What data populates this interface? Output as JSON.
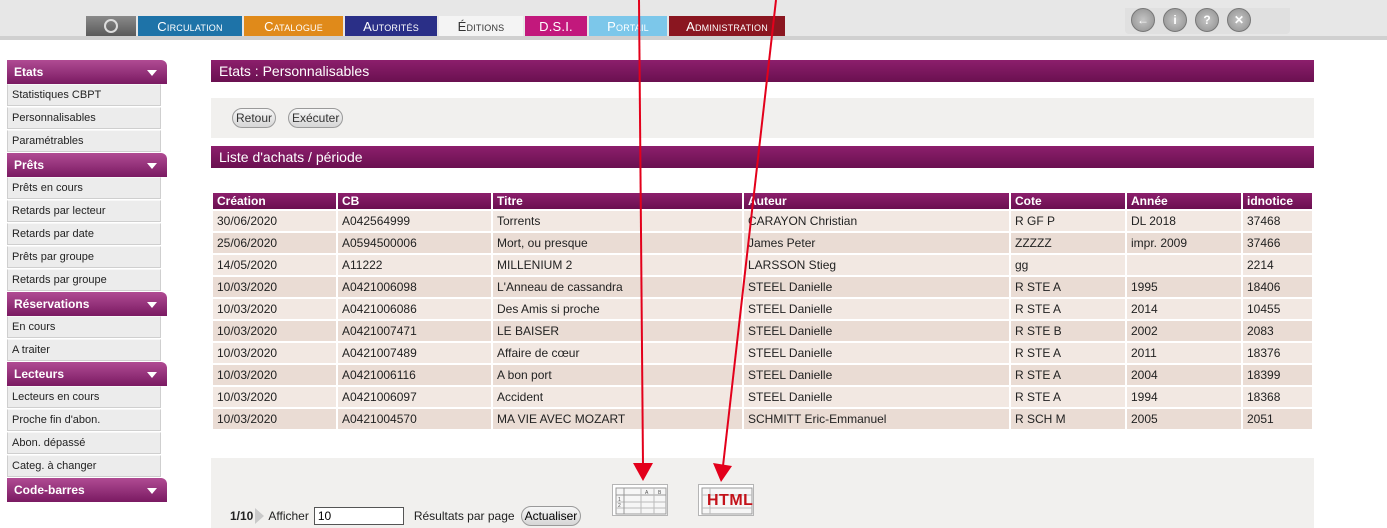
{
  "nav": {
    "tabs": [
      "Circulation",
      "Catalogue",
      "Autorités",
      "Éditions",
      "D.S.I.",
      "Portail",
      "Administration"
    ],
    "active_tab": "Éditions",
    "colors": {
      "accent": "#7a1a62",
      "circulation": "#1e73a8",
      "catalogue": "#e08a1a",
      "autorites": "#2a2f87",
      "dsi": "#c2187c",
      "portail": "#7cc7ea",
      "administration": "#8a1620"
    },
    "right_icons": [
      "back-icon",
      "info-icon",
      "help-icon",
      "close-icon"
    ]
  },
  "sidebar": {
    "groups": [
      {
        "title": "Etats",
        "items": [
          "Statistiques CBPT",
          "Personnalisables",
          "Paramétrables"
        ]
      },
      {
        "title": "Prêts",
        "items": [
          "Prêts en cours",
          "Retards par lecteur",
          "Retards par date",
          "Prêts par groupe",
          "Retards par groupe"
        ]
      },
      {
        "title": "Réservations",
        "items": [
          "En cours",
          "A traiter"
        ]
      },
      {
        "title": "Lecteurs",
        "items": [
          "Lecteurs en cours",
          "Proche fin d'abon.",
          "Abon. dépassé",
          "Categ. à changer"
        ]
      },
      {
        "title": "Code-barres",
        "items": []
      }
    ]
  },
  "main": {
    "section_title": "Etats : Personnalisables",
    "buttons": {
      "back": "Retour",
      "execute": "Exécuter"
    },
    "report_title": "Liste d'achats / période",
    "table": {
      "headers": [
        "Création",
        "CB",
        "Titre",
        "Auteur",
        "Cote",
        "Année",
        "idnotice"
      ],
      "rows": [
        [
          "30/06/2020",
          "A042564999",
          "Torrents",
          "CARAYON Christian",
          "R GF P",
          "DL 2018",
          "37468"
        ],
        [
          "25/06/2020",
          "A0594500006",
          "Mort, ou presque",
          "James Peter",
          "ZZZZZ",
          "impr. 2009",
          "37466"
        ],
        [
          "14/05/2020",
          "A11222",
          "MILLENIUM 2",
          "LARSSON Stieg",
          "gg",
          "",
          "2214"
        ],
        [
          "10/03/2020",
          "A0421006098",
          "L'Anneau de cassandra",
          "STEEL Danielle",
          "R STE A",
          "1995",
          "18406"
        ],
        [
          "10/03/2020",
          "A0421006086",
          "Des Amis si proche",
          "STEEL Danielle",
          "R STE A",
          "2014",
          "10455"
        ],
        [
          "10/03/2020",
          "A0421007471",
          "LE BAISER",
          "STEEL Danielle",
          "R STE B",
          "2002",
          "2083"
        ],
        [
          "10/03/2020",
          "A0421007489",
          "Affaire de cœur",
          "STEEL Danielle",
          "R STE A",
          "2011",
          "18376"
        ],
        [
          "10/03/2020",
          "A0421006116",
          "A bon port",
          "STEEL Danielle",
          "R STE A",
          "2004",
          "18399"
        ],
        [
          "10/03/2020",
          "A0421006097",
          "Accident",
          "STEEL Danielle",
          "R STE A",
          "1994",
          "18368"
        ],
        [
          "10/03/2020",
          "A0421004570",
          "MA VIE AVEC MOZART",
          "SCHMITT Eric-Emmanuel",
          "R SCH M",
          "2005",
          "2051"
        ]
      ]
    },
    "pager": {
      "page": "1/10",
      "show_label": "Afficher",
      "per_page_value": "10",
      "per_page_label": "Résultats par page",
      "refresh_label": "Actualiser"
    },
    "export": {
      "spreadsheet_icon": "spreadsheet-export-icon",
      "html_icon_label": "HTML"
    }
  }
}
